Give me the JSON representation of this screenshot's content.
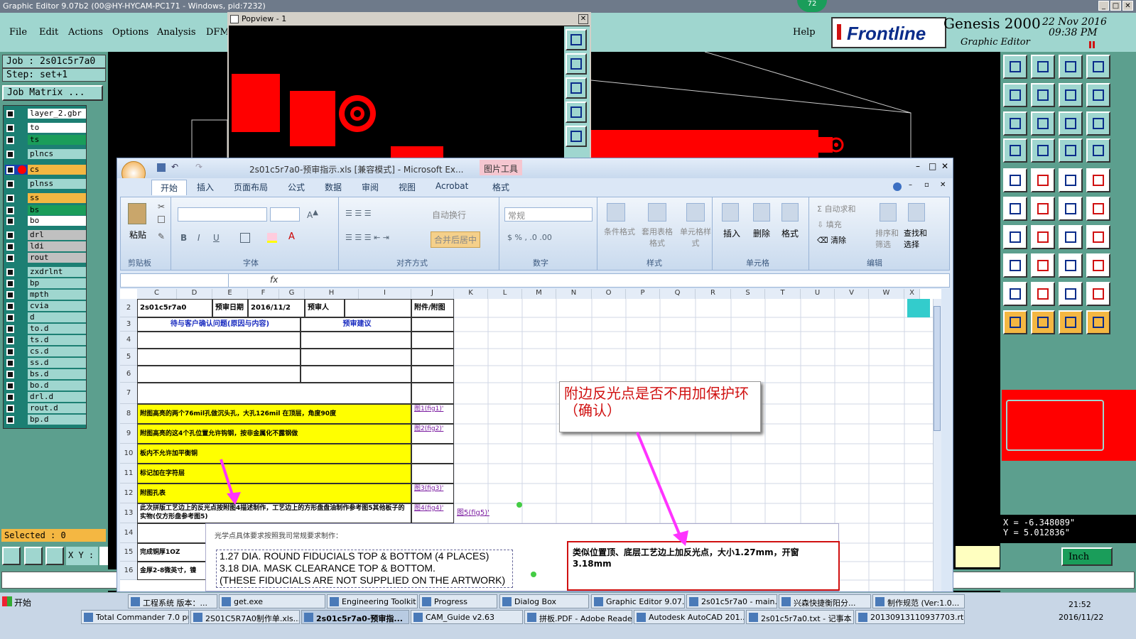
{
  "app": {
    "title": "Graphic Editor 9.07b2 (00@HY-HYCAM-PC171 - Windows, pid:7232)",
    "menu": [
      "File",
      "Edit",
      "Actions",
      "Options",
      "Analysis",
      "DFM"
    ],
    "help": "Help",
    "brand": "Frontline",
    "product": "Genesis 2000",
    "product_sub": "Graphic Editor",
    "date": "22 Nov 2016",
    "time": "09:38 PM",
    "badge": "72"
  },
  "left": {
    "job": "Job : 2s01c5r7a0",
    "step": "Step: set+1",
    "job_matrix": "Job Matrix ...",
    "layers": [
      {
        "name": "layer_2.gbr",
        "color": "#ffffff"
      },
      {
        "name": "to",
        "color": "#ffffff"
      },
      {
        "name": "ts",
        "color": "#1a9d5a"
      },
      {
        "name": "plncs",
        "color": "#9fd6cf"
      },
      {
        "name": "cs",
        "color": "#f4b742"
      },
      {
        "name": "plnss",
        "color": "#9fd6cf"
      },
      {
        "name": "ss",
        "color": "#f4b742"
      },
      {
        "name": "bs",
        "color": "#1a9d5a"
      },
      {
        "name": "bo",
        "color": "#ffffff"
      },
      {
        "name": "drl",
        "color": "#c0c0c0"
      },
      {
        "name": "ldi",
        "color": "#c0c0c0"
      },
      {
        "name": "rout",
        "color": "#c0c0c0"
      },
      {
        "name": "zxdrlnt",
        "color": "#9fd6cf"
      },
      {
        "name": "bp",
        "color": "#9fd6cf"
      },
      {
        "name": "mpth",
        "color": "#9fd6cf"
      },
      {
        "name": "cvia",
        "color": "#9fd6cf"
      },
      {
        "name": "d",
        "color": "#9fd6cf"
      },
      {
        "name": "to.d",
        "color": "#9fd6cf"
      },
      {
        "name": "ts.d",
        "color": "#9fd6cf"
      },
      {
        "name": "cs.d",
        "color": "#9fd6cf"
      },
      {
        "name": "ss.d",
        "color": "#9fd6cf"
      },
      {
        "name": "bs.d",
        "color": "#9fd6cf"
      },
      {
        "name": "bo.d",
        "color": "#9fd6cf"
      },
      {
        "name": "drl.d",
        "color": "#9fd6cf"
      },
      {
        "name": "rout.d",
        "color": "#9fd6cf"
      },
      {
        "name": "bp.d",
        "color": "#9fd6cf"
      }
    ],
    "selected": "Selected : 0",
    "xy_label": "X Y :"
  },
  "right": {
    "x": "X = -6.348089\"",
    "y": "Y = 5.012836\"",
    "units": "Inch"
  },
  "popview": {
    "title": "Popview - 1"
  },
  "excel": {
    "title": "2s01c5r7a0-预审指示.xls [兼容模式] - Microsoft Ex...",
    "picture_tools": "图片工具",
    "tabs": [
      "开始",
      "插入",
      "页面布局",
      "公式",
      "数据",
      "审阅",
      "视图",
      "Acrobat",
      "格式"
    ],
    "groups": [
      "剪贴板",
      "字体",
      "对齐方式",
      "数字",
      "样式",
      "单元格",
      "编辑"
    ],
    "buttons": {
      "paste": "粘贴",
      "wrap": "自动换行",
      "merge": "合并后居中",
      "numfmt": "常规",
      "cond": "条件格式",
      "table": "套用表格格式",
      "cellstyle": "单元格样式",
      "insert": "插入",
      "delete": "删除",
      "format": "格式",
      "autosum": "自动求和",
      "fill": "填充",
      "clear": "清除",
      "sort": "排序和筛选",
      "find": "查找和选择"
    },
    "columns": [
      "C",
      "D",
      "E",
      "F",
      "G",
      "H",
      "I",
      "J",
      "K",
      "L",
      "M",
      "N",
      "O",
      "P",
      "Q",
      "R",
      "S",
      "T",
      "U",
      "V",
      "W",
      "X"
    ],
    "rows": [
      "2",
      "3",
      "4",
      "5",
      "6",
      "7",
      "8",
      "9",
      "10",
      "11",
      "12",
      "13",
      "14",
      "15",
      "16"
    ],
    "cells": {
      "job": "2s01c5r7a0",
      "pre_date_lbl": "预审日期",
      "pre_date": "2016/11/2",
      "reviewer_lbl": "预审人",
      "attach_lbl": "附件/附图",
      "q_header": "待与客户确认问题(原因与内容)",
      "advice_header": "预审建议",
      "r8": "附图高亮的两个76mil孔做沉头孔，大孔126mil 在顶层，角度90度",
      "r9": "附图高亮的这4个孔位置允许钩钢，按非金属化不露钢做",
      "r10": "板内不允许加平衡铜",
      "r11": "标记加在字符层",
      "r12": "附图孔表",
      "r13": "此次拼版工艺边上的反光点按附图4描述制作，工艺边上的方形盘盘油制作参考图5其他板子的实物(仅方形盘参考图5)",
      "r15": "完成铜厚1OZ",
      "r16": "金厚2-8微英寸，镍",
      "fig1": "图1(fig1)'",
      "fig2": "图2(fig2)'",
      "fig3": "图3(fig3)'",
      "fig4": "图4(fig4)'",
      "fig5": "图5(fig5)'"
    },
    "note_top": "附边反光点是否不用加保护环（确认）",
    "note_box": "光学点具体要求按照我司常规要求制作：",
    "note_lines": [
      "1.27 DIA. ROUND FIDUCIALS TOP & BOTTOM (4 PLACES)",
      "3.18 DIA. MASK CLEARANCE TOP & BOTTOM.",
      "(THESE FIDUCIALS ARE NOT SUPPLIED ON THE ARTWORK)"
    ],
    "note_right": "类似位置顶、底层工艺边上加反光点，大小1.27mm，开窗3.18mm"
  },
  "taskbar": {
    "start": "开始",
    "row1": [
      "工程系统 版本：...",
      "get.exe",
      "Engineering Toolkit ...",
      "Progress",
      "Dialog Box",
      "Graphic Editor 9.07...",
      "2s01c5r7a0 - main...",
      "兴森快捷衡阳分...",
      "制作规范 (Ver:1.0..."
    ],
    "row2": [
      "Total Commander 7.0 pu...",
      "2S01C5R7A0制作单.xls...",
      "2s01c5r7a0-预审指...",
      "CAM_Guide v2.63",
      "拼板.PDF - Adobe Reader",
      "Autodesk AutoCAD 201...",
      "2s01c5r7a0.txt - 记事本",
      "20130913110937703.rt..."
    ],
    "clock_time": "21:52",
    "clock_date": "2016/11/22"
  }
}
